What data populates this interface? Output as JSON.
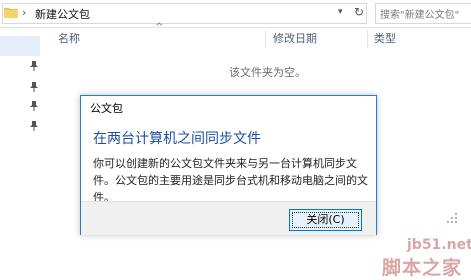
{
  "address_bar": {
    "path": "新建公文包",
    "chevron": "›",
    "dropdown_glyph": "▾",
    "refresh_glyph": "↻",
    "search_placeholder": "搜索\"新建公文包\""
  },
  "columns": {
    "sort_glyph": "^",
    "name": "名称",
    "modified": "修改日期",
    "type": "类型"
  },
  "empty_message": "该文件夹为空。",
  "dialog": {
    "title": "公文包",
    "heading": "在两台计算机之间同步文件",
    "body": "你可以创建新的公文包文件夹来与另一台计算机同步文件。公文包的主要用途是同步台式机和移动电脑之间的文件。",
    "close_button": "关闭(C)"
  },
  "watermark": {
    "url": "jb51.net",
    "name": "脚本之家"
  },
  "icons": [
    "folder-icon",
    "chevron-right-icon",
    "dropdown-icon",
    "refresh-icon",
    "pin-icon",
    "sort-up-icon",
    "resize-grip-icon"
  ]
}
